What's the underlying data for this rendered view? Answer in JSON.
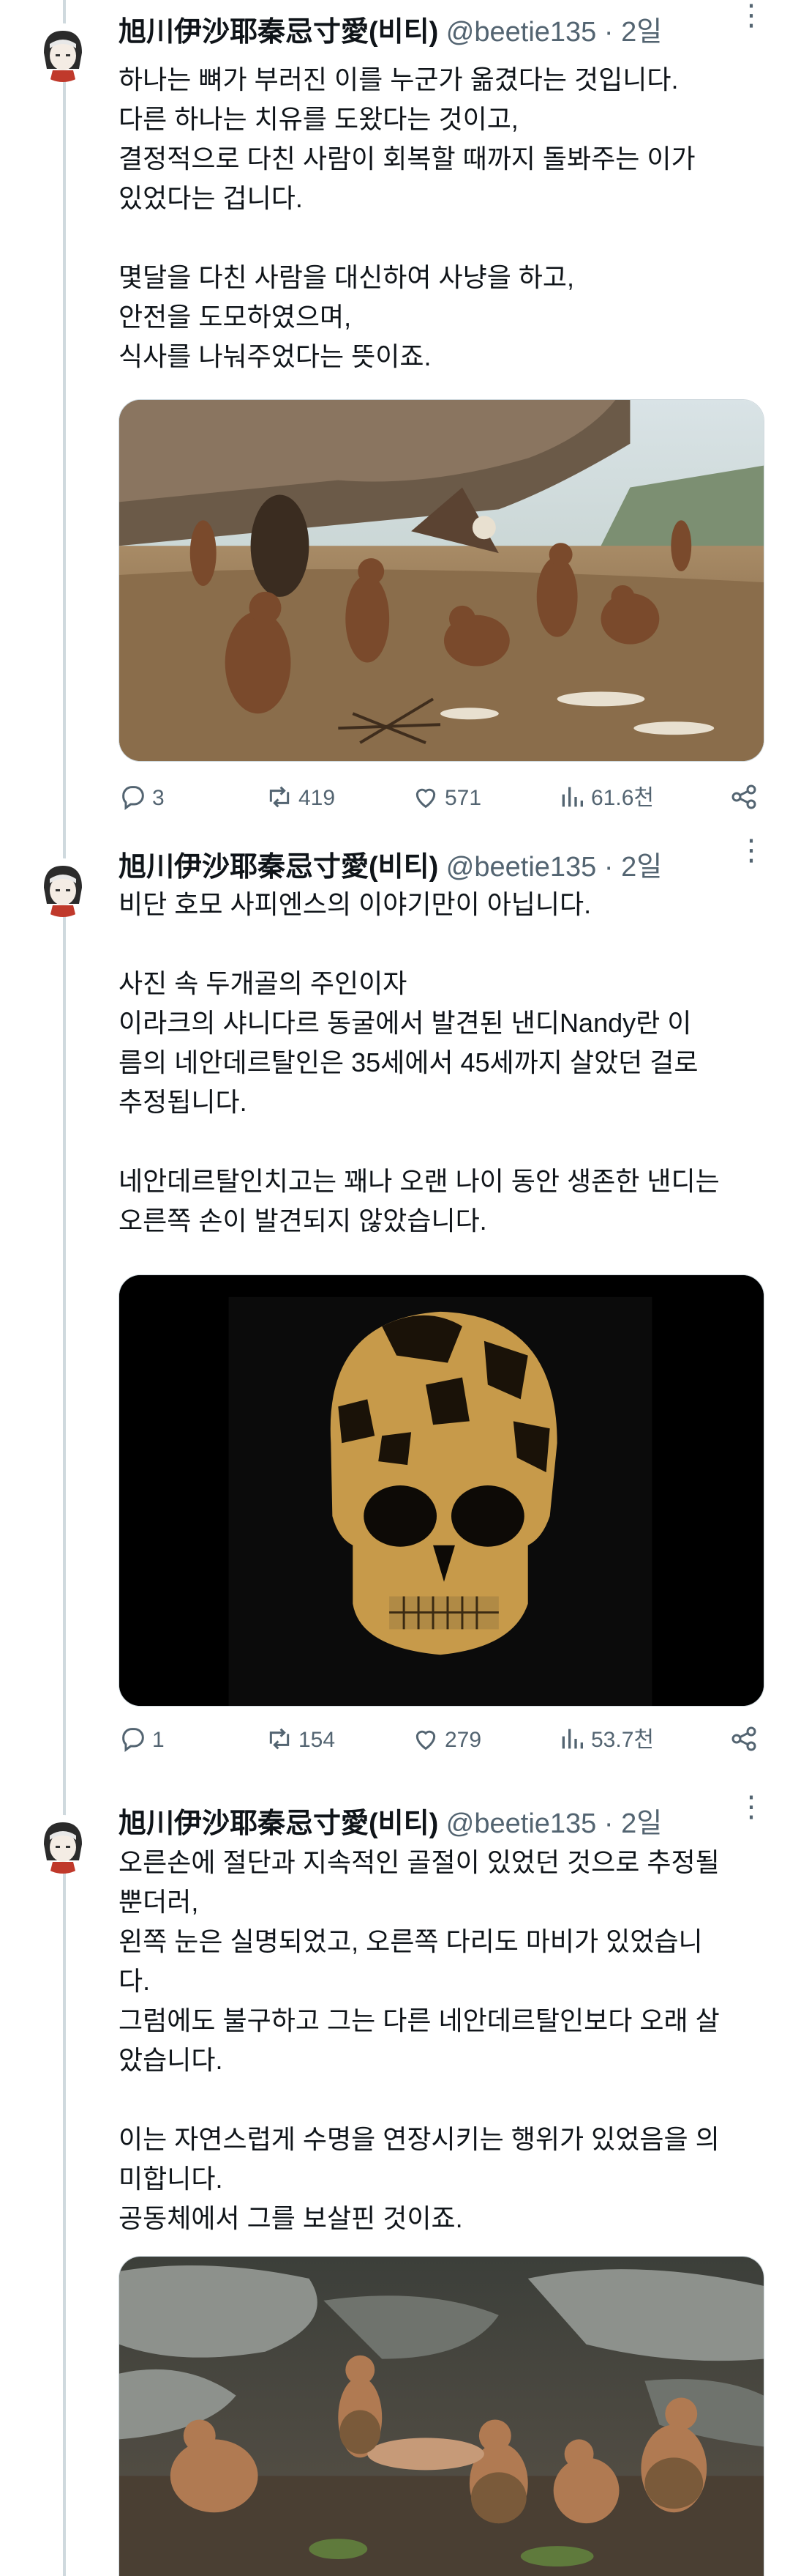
{
  "tweets": [
    {
      "name": "旭川伊沙耶秦忌寸愛(비티)",
      "handle": "@beetie135",
      "time": "· 2일",
      "lines": [
        "하나는 뼈가 부러진 이를 누군가 옮겼다는 것입니다.",
        "다른 하나는 치유를 도왔다는 것이고,",
        "결정적으로 다친 사람이 회복할 때까지 돌봐주는 이가",
        "있었다는 겁니다.",
        "",
        "몇달을 다친 사람을 대신하여 사냥을 하고,",
        "안전을 도모하였으며,",
        "식사를 나눠주었다는 뜻이죠."
      ],
      "stats": {
        "replies": "3",
        "retweets": "419",
        "likes": "571",
        "views": "61.6천"
      }
    },
    {
      "name": "旭川伊沙耶秦忌寸愛(비티)",
      "handle": "@beetie135",
      "time": "· 2일",
      "lines": [
        "비단 호모 사피엔스의 이야기만이 아닙니다.",
        "",
        "사진 속 두개골의 주인이자",
        "이라크의 샤니다르 동굴에서 발견된 낸디Nandy란 이",
        "름의 네안데르탈인은 35세에서 45세까지 살았던 걸로",
        "추정됩니다.",
        "",
        "네안데르탈인치고는 꽤나 오랜 나이 동안 생존한 낸디는",
        "오른쪽 손이 발견되지 않았습니다."
      ],
      "stats": {
        "replies": "1",
        "retweets": "154",
        "likes": "279",
        "views": "53.7천"
      }
    },
    {
      "name": "旭川伊沙耶秦忌寸愛(비티)",
      "handle": "@beetie135",
      "time": "· 2일",
      "lines": [
        "오른손에 절단과 지속적인 골절이 있었던 것으로 추정될",
        "뿐더러,",
        "왼쪽 눈은 실명되었고, 오른쪽 다리도 마비가 있었습니",
        "다.",
        "그럼에도 불구하고 그는 다른 네안데르탈인보다 오래 살",
        "았습니다.",
        "",
        "이는 자연스럽게 수명을 연장시키는 행위가 있었음을 의",
        "미합니다.",
        "공동체에서 그를 보살핀 것이죠."
      ]
    }
  ],
  "icons": {
    "reply": "reply-icon",
    "retweet": "retweet-icon",
    "like": "heart-icon",
    "views": "views-chart-icon",
    "share": "share-icon",
    "more": "more-dots-icon"
  },
  "colors": {
    "text": "#0f1419",
    "muted": "#536471",
    "border": "#cfd9de"
  }
}
